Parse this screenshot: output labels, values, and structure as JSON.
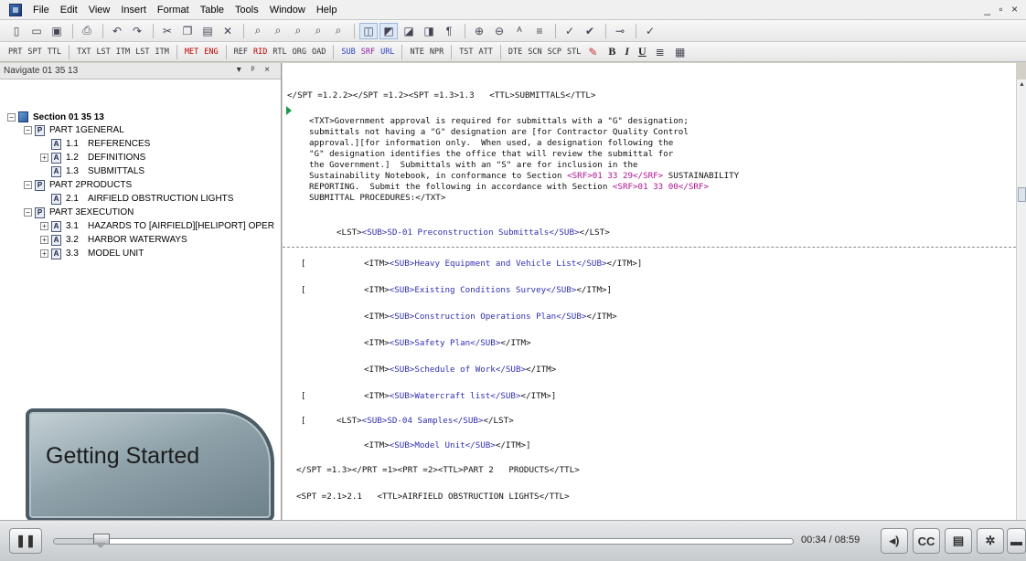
{
  "menu": [
    "File",
    "Edit",
    "View",
    "Insert",
    "Format",
    "Table",
    "Tools",
    "Window",
    "Help"
  ],
  "window_controls": "_ ▫ ×",
  "toolbar2": {
    "tags": [
      "PRT",
      "SPT",
      "TTL",
      "TXT",
      "LST",
      "ITM",
      "LST",
      "ITM",
      "MET",
      "ENG",
      "REF",
      "RID",
      "RTL",
      "ORG",
      "OAD",
      "SUB",
      "SRF",
      "URL",
      "NTE",
      "NPR",
      "TST",
      "ATT",
      "DTE",
      "SCN",
      "SCP",
      "STL"
    ],
    "bold": "B",
    "italic": "I",
    "underline": "U"
  },
  "nav": {
    "title": "Navigate 01 35 13",
    "header_controls": "▾ ᵖ ×",
    "tree": [
      {
        "level": 0,
        "icon": "",
        "expander": "−",
        "num": "",
        "label": "Section 01 35 13"
      },
      {
        "level": 1,
        "icon": "P",
        "expander": "−",
        "num": "PART 1",
        "label": "GENERAL"
      },
      {
        "level": 2,
        "icon": "A",
        "expander": "",
        "num": "1.1",
        "label": "REFERENCES"
      },
      {
        "level": 2,
        "icon": "A",
        "expander": "+",
        "num": "1.2",
        "label": "DEFINITIONS"
      },
      {
        "level": 2,
        "icon": "A",
        "expander": "",
        "num": "1.3",
        "label": "SUBMITTALS"
      },
      {
        "level": 1,
        "icon": "P",
        "expander": "−",
        "num": "PART 2",
        "label": "PRODUCTS"
      },
      {
        "level": 2,
        "icon": "A",
        "expander": "",
        "num": "2.1",
        "label": "AIRFIELD OBSTRUCTION LIGHTS"
      },
      {
        "level": 1,
        "icon": "P",
        "expander": "−",
        "num": "PART 3",
        "label": "EXECUTION"
      },
      {
        "level": 2,
        "icon": "A",
        "expander": "+",
        "num": "3.1",
        "label": "HAZARDS TO [AIRFIELD][HELIPORT] OPER"
      },
      {
        "level": 2,
        "icon": "A",
        "expander": "+",
        "num": "3.2",
        "label": "HARBOR WATERWAYS"
      },
      {
        "level": 2,
        "icon": "A",
        "expander": "+",
        "num": "3.3",
        "label": "MODEL UNIT"
      }
    ]
  },
  "overlay": {
    "title": "Getting Started"
  },
  "editor": {
    "line1": "</SPT =1.2.2></SPT =1.2><SPT =1.3>1.3   <TTL>SUBMITTALS</TTL>",
    "para": [
      "<TXT>Government approval is required for submittals with a \"G\" designation;",
      "submittals not having a \"G\" designation are [for Contractor Quality Control",
      "approval.][for information only.  When used, a designation following the",
      "\"G\" designation identifies the office that will review the submittal for",
      "the Government.]  Submittals with an \"S\" are for inclusion in the",
      "Sustainability Notebook, in conformance to Section ",
      "REPORTING.  Submit the following in accordance with Section ",
      "SUBMITTAL PROCEDURES:</TXT>"
    ],
    "srf1": "<SRF>01 33 29</SRF>",
    "after_srf1": " SUSTAINABILITY",
    "srf2": "<SRF>01 33 00</SRF>",
    "lst_open": "<LST>",
    "sd01": "<SUB>SD-01 Preconstruction Submittals</SUB>",
    "lst_close": "</LST>",
    "items": [
      {
        "bracket": "[",
        "sub": "<SUB>Heavy Equipment and Vehicle List</SUB>",
        "close": "</ITM>]"
      },
      {
        "bracket": "[",
        "sub": "<SUB>Existing Conditions Survey</SUB>",
        "close": "</ITM>]"
      },
      {
        "bracket": "",
        "sub": "<SUB>Construction Operations Plan</SUB>",
        "close": "</ITM>"
      },
      {
        "bracket": "",
        "sub": "<SUB>Safety Plan</SUB>",
        "close": "</ITM>"
      },
      {
        "bracket": "",
        "sub": "<SUB>Schedule of Work</SUB>",
        "close": "</ITM>"
      },
      {
        "bracket": "[",
        "sub": "<SUB>Watercraft list</SUB>",
        "close": "</ITM>]"
      }
    ],
    "itm_open": "<ITM>",
    "sd04_bracket": "[",
    "sd04_sub": "<SUB>SD-04 Samples</SUB>",
    "model_unit_sub": "<SUB>Model Unit</SUB>",
    "model_unit_close": "</ITM>]",
    "line_end1": "</SPT =1.3></PRT =1><PRT =2><TTL>PART 2   PRODUCTS</TTL>",
    "line_end2": "<SPT =2.1>2.1   <TTL>AIRFIELD OBSTRUCTION LIGHTS</TTL>"
  },
  "player": {
    "time": "00:34 / 08:59",
    "cc": "CC",
    "progress": 0.063
  }
}
